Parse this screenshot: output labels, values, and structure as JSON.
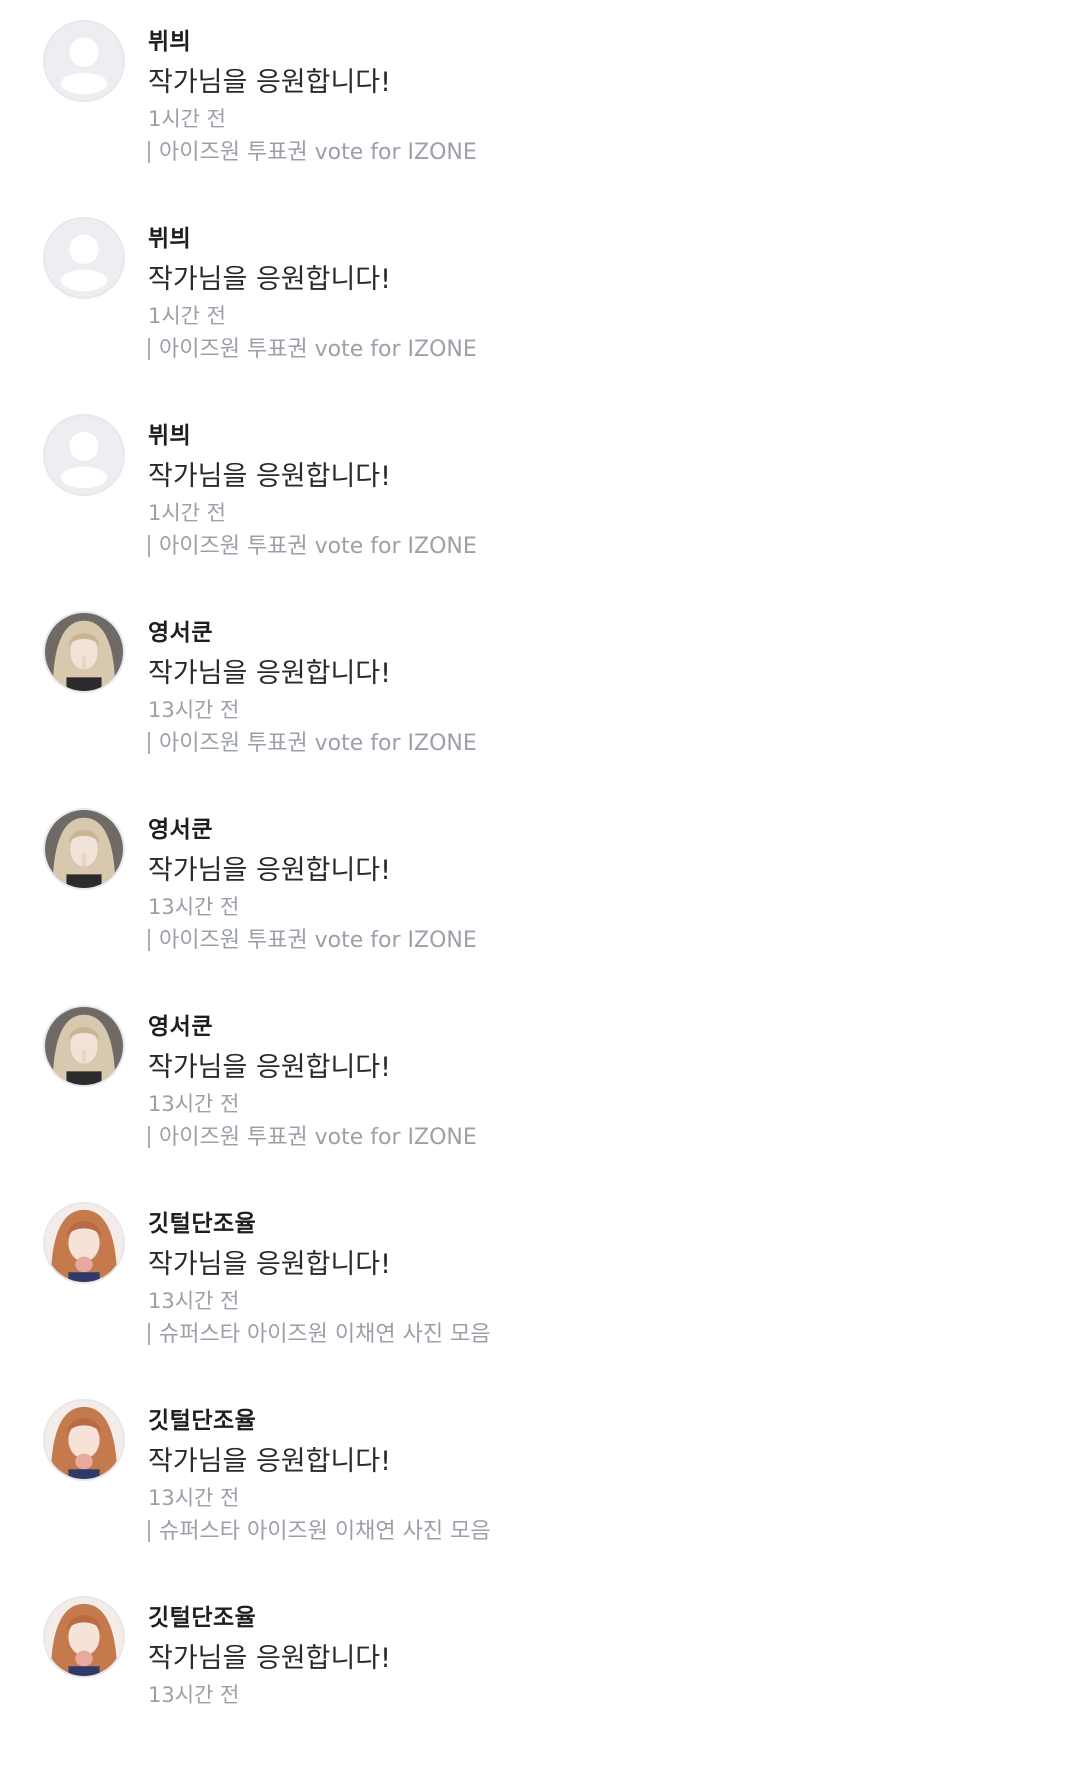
{
  "feed": {
    "items": [
      {
        "username": "뷔븨",
        "message": "작가님을 응원합니다!",
        "time": "1시간 전",
        "source": "아이즈원 투표권 vote for IZONE",
        "avatar": "default-profile-icon"
      },
      {
        "username": "뷔븨",
        "message": "작가님을 응원합니다!",
        "time": "1시간 전",
        "source": "아이즈원 투표권 vote for IZONE",
        "avatar": "default-profile-icon"
      },
      {
        "username": "뷔븨",
        "message": "작가님을 응원합니다!",
        "time": "1시간 전",
        "source": "아이즈원 투표권 vote for IZONE",
        "avatar": "default-profile-icon"
      },
      {
        "username": "영서쿤",
        "message": "작가님을 응원합니다!",
        "time": "13시간 전",
        "source": "아이즈원 투표권 vote for IZONE",
        "avatar": "user-photo-blonde"
      },
      {
        "username": "영서쿤",
        "message": "작가님을 응원합니다!",
        "time": "13시간 전",
        "source": "아이즈원 투표권 vote for IZONE",
        "avatar": "user-photo-blonde"
      },
      {
        "username": "영서쿤",
        "message": "작가님을 응원합니다!",
        "time": "13시간 전",
        "source": "아이즈원 투표권 vote for IZONE",
        "avatar": "user-photo-blonde"
      },
      {
        "username": "깃털단조율",
        "message": "작가님을 응원합니다!",
        "time": "13시간 전",
        "source": "슈퍼스타 아이즈원 이채연 사진 모음",
        "avatar": "user-photo-auburn"
      },
      {
        "username": "깃털단조율",
        "message": "작가님을 응원합니다!",
        "time": "13시간 전",
        "source": "슈퍼스타 아이즈원 이채연 사진 모음",
        "avatar": "user-photo-auburn"
      },
      {
        "username": "깃털단조율",
        "message": "작가님을 응원합니다!",
        "time": "13시간 전",
        "source": "",
        "avatar": "user-photo-auburn"
      }
    ]
  },
  "colors": {
    "username": "#1e1e1e",
    "message": "#2a2a2a",
    "meta": "#9ba0a8",
    "default_avatar_bg": "#eceef2",
    "default_avatar_fg": "#ffffff"
  }
}
